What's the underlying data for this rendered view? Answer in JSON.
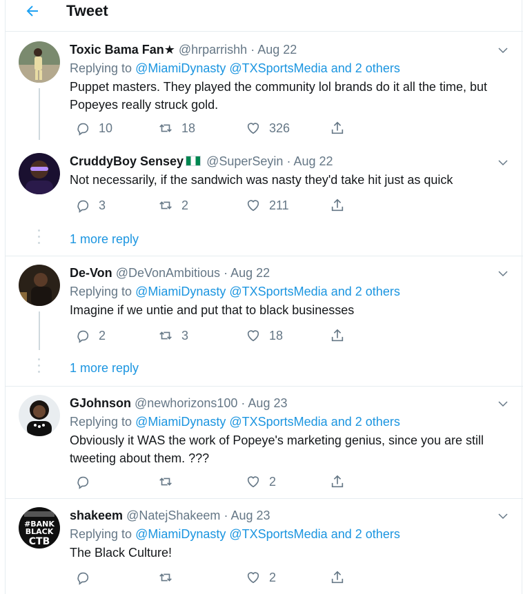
{
  "header": {
    "title": "Tweet"
  },
  "tweets": [
    {
      "name": "Toxic Bama Fan★",
      "handle": "@hrparrishh",
      "dot": "·",
      "date": "Aug 22",
      "replying_label": "Replying to",
      "replying_users": "@MiamiDynasty @TXSportsMedia",
      "replying_and": "and",
      "replying_others": "2 others",
      "text": "Puppet masters. They played the community lol brands do it all the time, but Popeyes really struck gold.",
      "replies": "10",
      "retweets": "18",
      "likes": "326"
    },
    {
      "name": "CruddyBoy Sensey",
      "handle": "@SuperSeyin",
      "dot": "·",
      "date": "Aug 22",
      "text": "Not necessarily,  if the sandwich was nasty they'd take hit just as quick",
      "replies": "3",
      "retweets": "2",
      "likes": "211",
      "more_reply": "1 more reply"
    },
    {
      "name": "De-Von",
      "handle": "@DeVonAmbitious",
      "dot": "·",
      "date": "Aug 22",
      "replying_label": "Replying to",
      "replying_users": "@MiamiDynasty @TXSportsMedia",
      "replying_and": "and",
      "replying_others": "2 others",
      "text": "Imagine if we untie and put that to black businesses",
      "replies": "2",
      "retweets": "3",
      "likes": "18",
      "more_reply": "1 more reply"
    },
    {
      "name": "GJohnson",
      "handle": "@newhorizons100",
      "dot": "·",
      "date": "Aug 23",
      "replying_label": "Replying to",
      "replying_users": "@MiamiDynasty @TXSportsMedia",
      "replying_and": "and",
      "replying_others": "2 others",
      "text": "Obviously it WAS the work of Popeye's marketing genius, since you are still tweeting about them. ???",
      "replies": "",
      "retweets": "",
      "likes": "2"
    },
    {
      "name": "shakeem",
      "handle": "@NatejShakeem",
      "dot": "·",
      "date": "Aug 23",
      "replying_label": "Replying to",
      "replying_users": "@MiamiDynasty @TXSportsMedia",
      "replying_and": "and",
      "replying_others": "2 others",
      "text": "The Black Culture!",
      "replies": "",
      "retweets": "",
      "likes": "2",
      "avatar_text": [
        "#BANK",
        "BLACK",
        "CTB"
      ]
    }
  ],
  "colors": {
    "accent": "#1da1f2",
    "link": "#1b95e0",
    "muted": "#657786",
    "border": "#e6ecf0"
  },
  "icons": {
    "back": "arrow-left-icon",
    "reply": "reply-icon",
    "retweet": "retweet-icon",
    "like": "heart-icon",
    "share": "share-icon",
    "caret": "chevron-down-icon",
    "flag": "nigeria-flag-icon"
  }
}
